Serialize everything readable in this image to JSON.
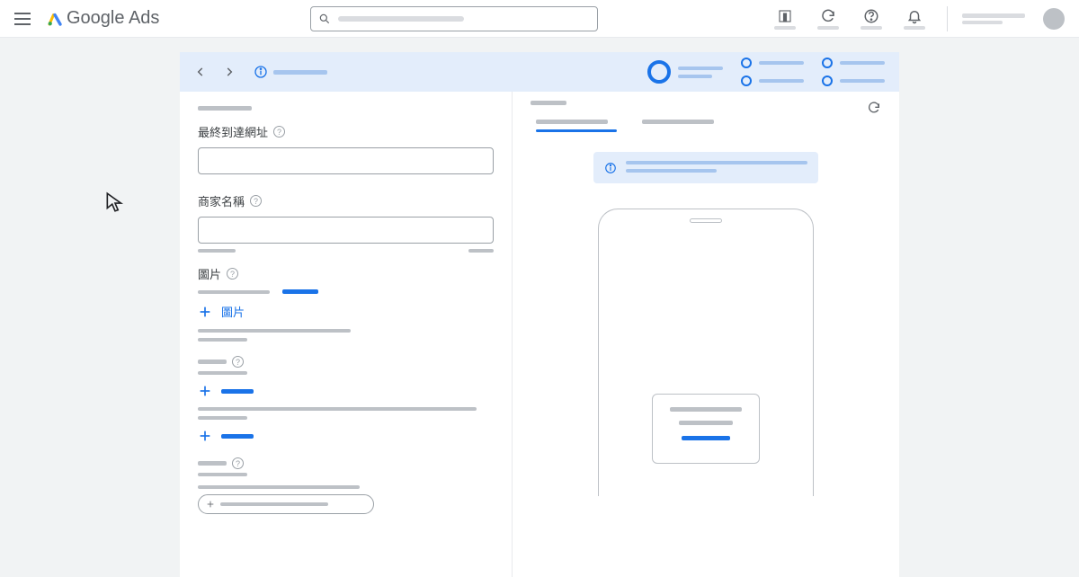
{
  "header": {
    "logo_text_1": "Google",
    "logo_text_2": "Ads"
  },
  "form": {
    "final_url_label": "最終到達網址",
    "business_name_label": "商家名稱",
    "images_label": "圖片",
    "add_image_label": "圖片"
  },
  "icons": {
    "menu": "menu",
    "search": "search",
    "refresh": "refresh",
    "help": "help",
    "notification": "notification",
    "info": "info",
    "plus": "plus",
    "reports": "reports"
  }
}
